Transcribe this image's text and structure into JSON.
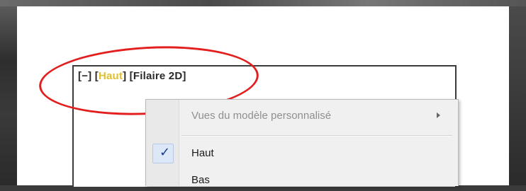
{
  "viewport": {
    "label_prefix": "[",
    "minus": "−",
    "sep1": "] [",
    "view_name": "Haut",
    "sep2": "] [",
    "visual_style": "Filaire 2D",
    "label_suffix": "]"
  },
  "context_menu": {
    "items": [
      {
        "label": "Vues du modèle personnalisé",
        "enabled": false,
        "has_submenu": true
      },
      {
        "label": "Haut",
        "checked": true
      },
      {
        "label": "Bas"
      }
    ],
    "check_glyph": "✓"
  },
  "colors": {
    "annotation": "#e31e1e",
    "active_view_highlight": "#e0c030",
    "check": "#1d3f8a"
  }
}
